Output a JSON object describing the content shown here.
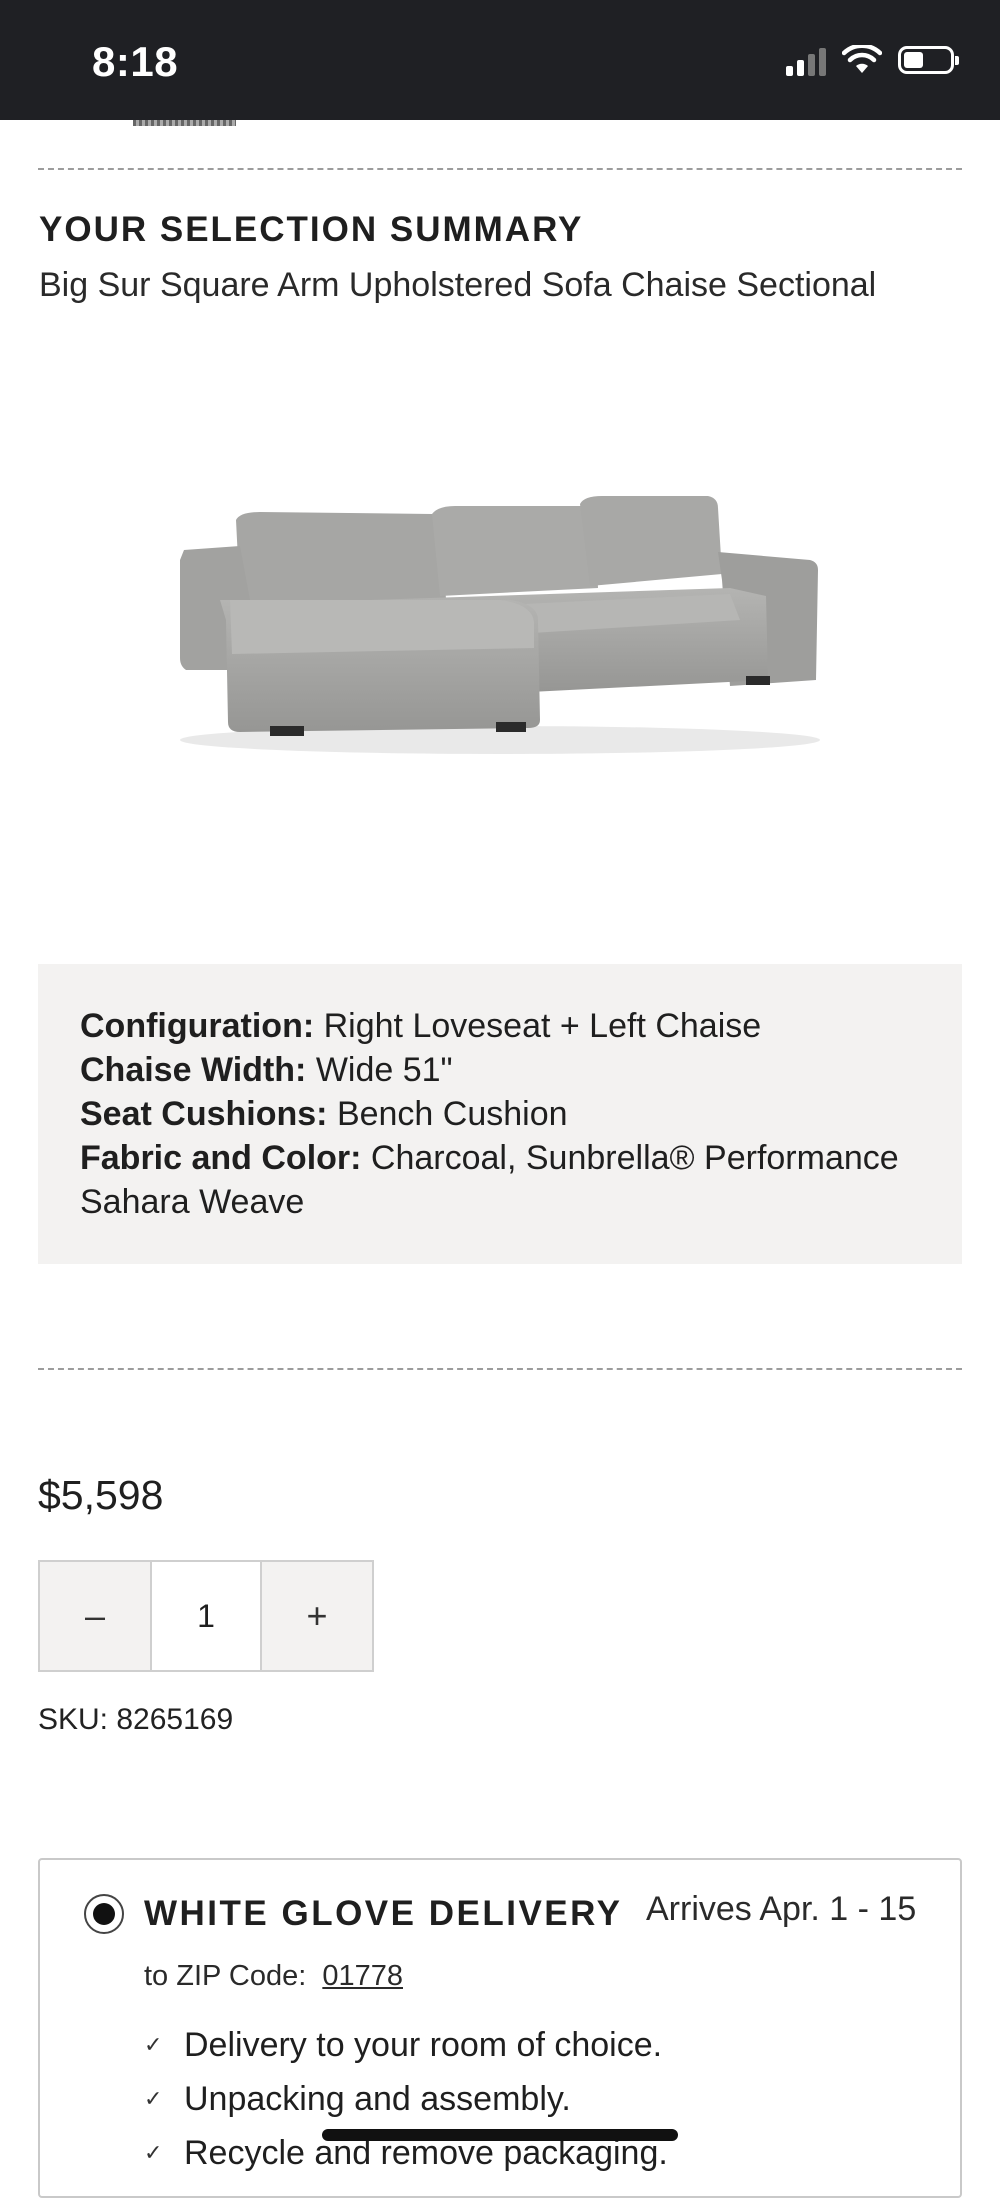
{
  "status_bar": {
    "time": "8:18"
  },
  "summary": {
    "heading": "YOUR SELECTION SUMMARY",
    "product_name": "Big Sur Square Arm Upholstered Sofa Chaise Sectional"
  },
  "details": [
    {
      "label": "Configuration:",
      "value": "Right Loveseat + Left Chaise"
    },
    {
      "label": "Chaise Width:",
      "value": "Wide 51\""
    },
    {
      "label": "Seat Cushions:",
      "value": "Bench Cushion"
    },
    {
      "label": "Fabric and Color:",
      "value": "Charcoal, Sunbrella® Performance Sahara Weave"
    }
  ],
  "price": "$5,598",
  "quantity": {
    "minus": "–",
    "value": "1",
    "plus": "+"
  },
  "sku": "SKU: 8265169",
  "delivery": {
    "title": "WHITE GLOVE DELIVERY",
    "arrives": "Arrives Apr. 1 - 15",
    "zip_label": "to ZIP Code:",
    "zip_code": "01778",
    "features": [
      "Delivery to your room of choice.",
      "Unpacking and assembly.",
      "Recycle and remove packaging."
    ]
  },
  "colors": {
    "status_bar_bg": "#1f2024",
    "panel_bg": "#f3f2f1",
    "sofa_fabric": "#a9a9a7"
  }
}
